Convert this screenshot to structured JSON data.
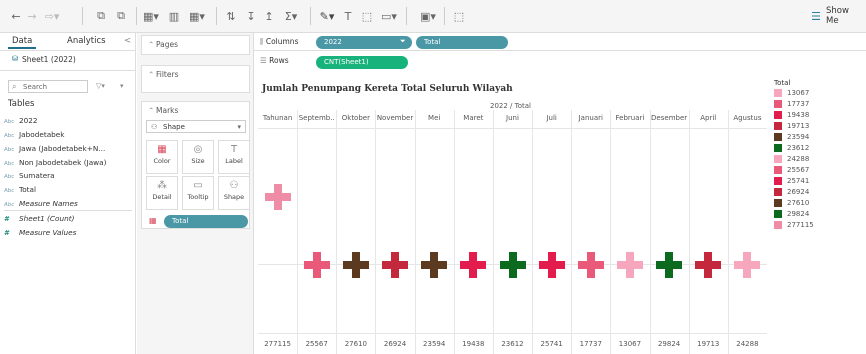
{
  "toolbar": {
    "show_me_label": "Show Me"
  },
  "data_pane": {
    "tab_data": "Data",
    "tab_analytics": "Analytics",
    "collapse_glyph": "<",
    "datasource": "Sheet1 (2022)",
    "search_placeholder": "Search",
    "tables_label": "Tables",
    "fields": [
      {
        "type": "Abc",
        "name": "2022"
      },
      {
        "type": "Abc",
        "name": "Jabodetabek"
      },
      {
        "type": "Abc",
        "name": "Jawa (Jabodetabek+N..."
      },
      {
        "type": "Abc",
        "name": "Non Jabodetabek (Jawa)"
      },
      {
        "type": "Abc",
        "name": "Sumatera"
      },
      {
        "type": "Abc",
        "name": "Total"
      },
      {
        "type": "Abc",
        "name": "Measure Names"
      },
      {
        "type": "#",
        "name": "Sheet1 (Count)"
      },
      {
        "type": "#",
        "name": "Measure Values"
      }
    ]
  },
  "cards": {
    "pages": "Pages",
    "filters": "Filters",
    "marks": "Marks",
    "mark_type": "Shape",
    "buttons": [
      {
        "label": "Color",
        "icon": "color-icon"
      },
      {
        "label": "Size",
        "icon": "size-icon"
      },
      {
        "label": "Label",
        "icon": "label-icon"
      },
      {
        "label": "Detail",
        "icon": "detail-icon"
      },
      {
        "label": "Tooltip",
        "icon": "tooltip-icon"
      },
      {
        "label": "Shape",
        "icon": "shape-icon"
      }
    ],
    "marks_pill": "Total"
  },
  "shelves": {
    "columns_label": "Columns",
    "rows_label": "Rows",
    "columns_pills": [
      "2022",
      "Total"
    ],
    "rows_pills": [
      "CNT(Sheet1)"
    ]
  },
  "viz": {
    "title": "Jumlah Penumpang Kereta Total Seluruh Wilayah",
    "header": "2022 / Total"
  },
  "chart_data": {
    "type": "scatter",
    "title": "Jumlah Penumpang Kereta Total Seluruh Wilayah",
    "xlabel": "2022 / Total",
    "categories": [
      "Tahunan",
      "Septemb..",
      "Oktober",
      "November",
      "Mei",
      "Maret",
      "Juni",
      "Juli",
      "Januari",
      "Februari",
      "Desember",
      "April",
      "Agustus"
    ],
    "totals": [
      "277115",
      "25567",
      "27610",
      "26924",
      "23594",
      "19438",
      "23612",
      "25741",
      "17737",
      "13067",
      "29824",
      "19713",
      "24288"
    ],
    "level": [
      "high",
      "low",
      "low",
      "low",
      "low",
      "low",
      "low",
      "low",
      "low",
      "low",
      "low",
      "low",
      "low"
    ],
    "colors": [
      "#f08da6",
      "#e8597a",
      "#5c3a1f",
      "#c4283d",
      "#5c3a1f",
      "#e21d4e",
      "#0b6a1e",
      "#e21d4e",
      "#e8597a",
      "#f6a7bd",
      "#0b6a1e",
      "#c4283d",
      "#f6a7bd"
    ]
  },
  "legend": {
    "title": "Total",
    "items": [
      {
        "label": "13067",
        "color": "#f6a7bd"
      },
      {
        "label": "17737",
        "color": "#e8597a"
      },
      {
        "label": "19438",
        "color": "#e21d4e"
      },
      {
        "label": "19713",
        "color": "#c4283d"
      },
      {
        "label": "23594",
        "color": "#5c3a1f"
      },
      {
        "label": "23612",
        "color": "#0b6a1e"
      },
      {
        "label": "24288",
        "color": "#f6a7bd"
      },
      {
        "label": "25567",
        "color": "#e8597a"
      },
      {
        "label": "25741",
        "color": "#e21d4e"
      },
      {
        "label": "26924",
        "color": "#c4283d"
      },
      {
        "label": "27610",
        "color": "#5c3a1f"
      },
      {
        "label": "29824",
        "color": "#0b6a1e"
      },
      {
        "label": "277115",
        "color": "#f08da6"
      }
    ]
  }
}
